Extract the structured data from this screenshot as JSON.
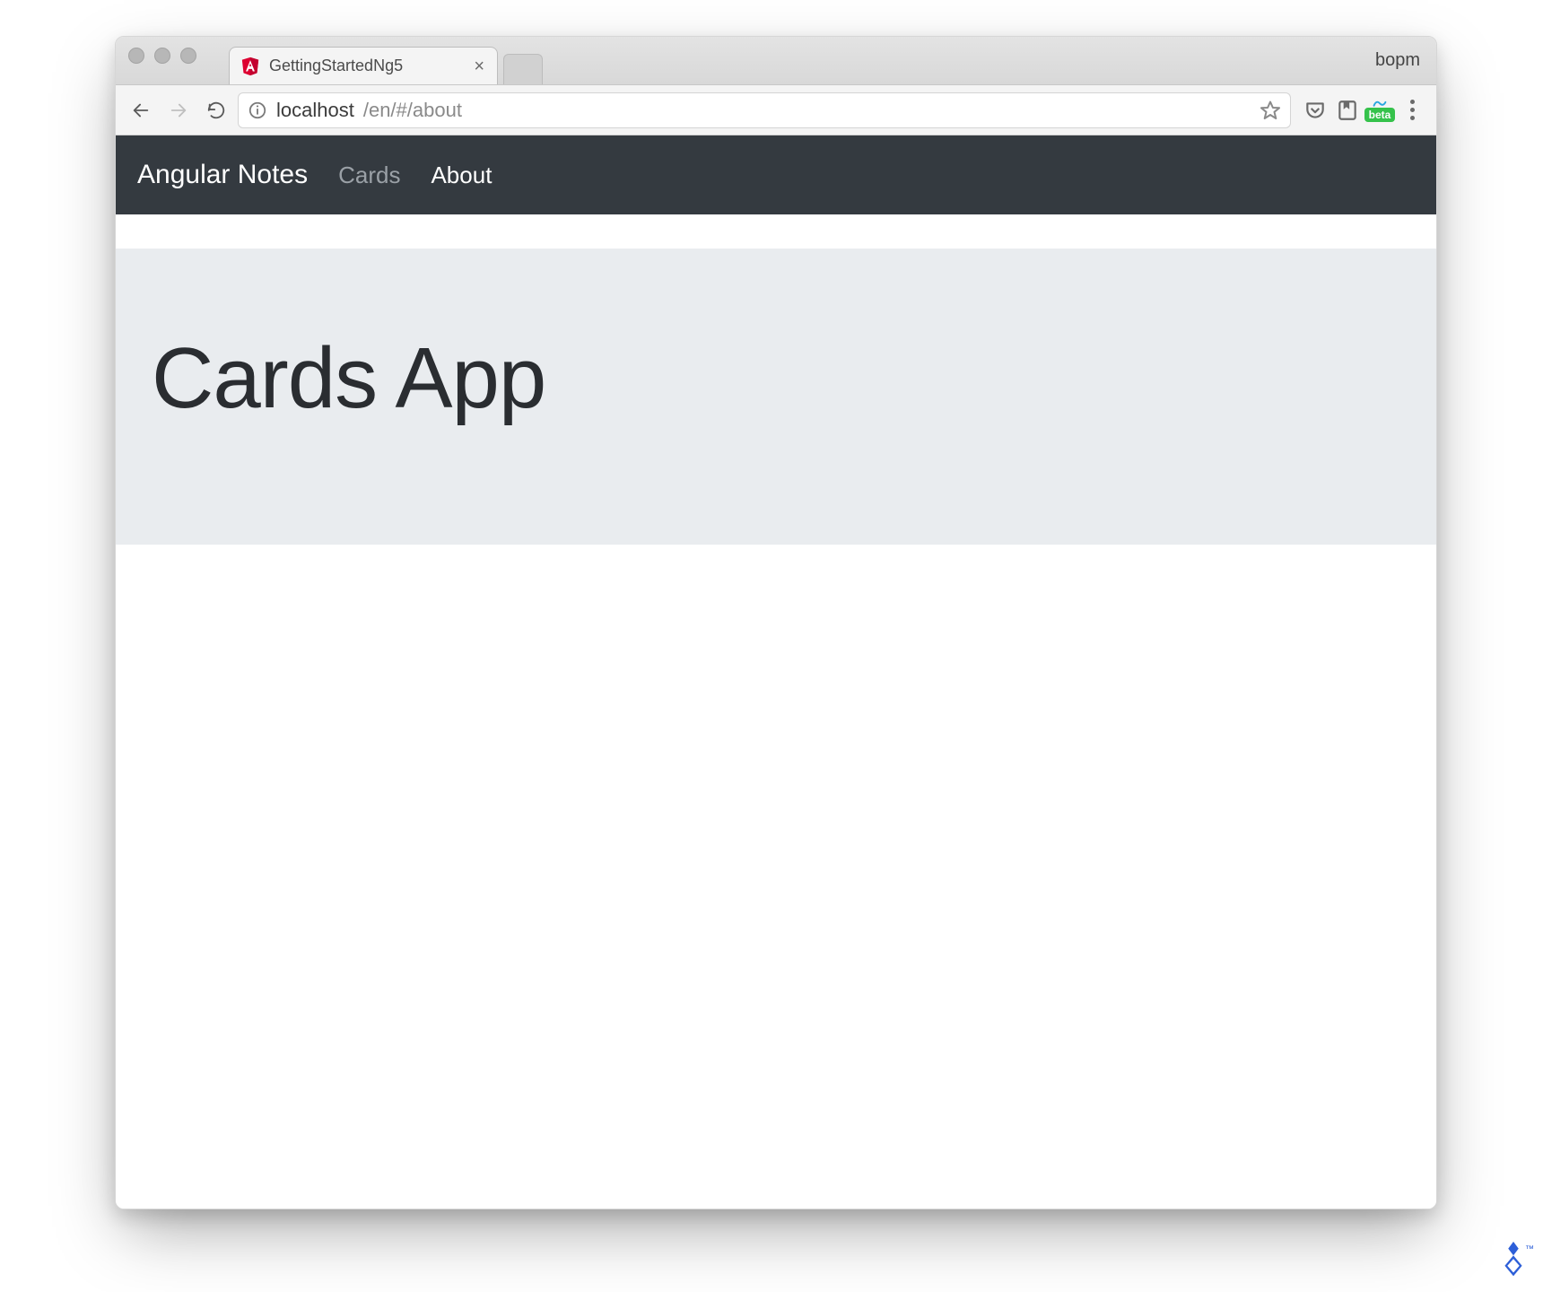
{
  "browser": {
    "tab_title": "GettingStartedNg5",
    "profile_name": "bopm",
    "url_host": "localhost",
    "url_rest": "/en/#/about",
    "beta_label": "beta"
  },
  "app": {
    "brand": "Angular Notes",
    "nav_cards": "Cards",
    "nav_about": "About",
    "page_title": "Cards App"
  }
}
